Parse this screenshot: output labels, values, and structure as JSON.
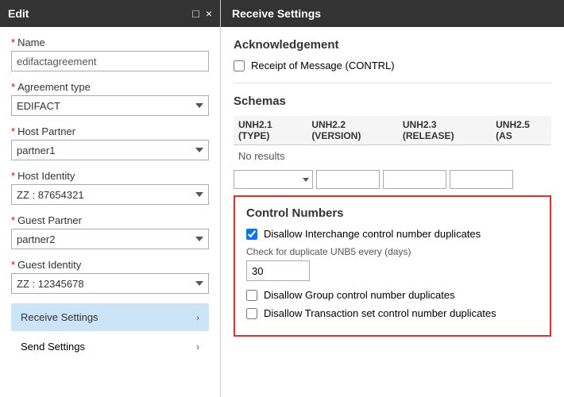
{
  "left": {
    "header": {
      "title": "Edit",
      "minimize_icon": "□",
      "close_icon": "×"
    },
    "fields": {
      "name_label": "Name",
      "name_value": "edifactagreement",
      "agreement_type_label": "Agreement type",
      "agreement_type_value": "EDIFACT",
      "host_partner_label": "Host Partner",
      "host_partner_value": "partner1",
      "host_identity_label": "Host Identity",
      "host_identity_value": "ZZ : 87654321",
      "guest_partner_label": "Guest Partner",
      "guest_partner_value": "partner2",
      "guest_identity_label": "Guest Identity",
      "guest_identity_value": "ZZ : 12345678"
    },
    "nav": {
      "receive_settings_label": "Receive Settings",
      "send_settings_label": "Send Settings"
    }
  },
  "right": {
    "header": {
      "title": "Receive Settings"
    },
    "acknowledgement": {
      "title": "Acknowledgement",
      "receipt_label": "Receipt of Message (CONTRL)"
    },
    "schemas": {
      "title": "Schemas",
      "columns": [
        "UNH2.1 (TYPE)",
        "UNH2.2 (VERSION)",
        "UNH2.3 (RELEASE)",
        "UNH2.5 (AS"
      ],
      "no_results": "No results"
    },
    "control_numbers": {
      "title": "Control Numbers",
      "disallow_interchange_label": "Disallow Interchange control number duplicates",
      "check_duplicate_label": "Check for duplicate UNB5 every (days)",
      "days_value": "30",
      "disallow_group_label": "Disallow Group control number duplicates",
      "disallow_transaction_label": "Disallow Transaction set control number duplicates"
    }
  }
}
